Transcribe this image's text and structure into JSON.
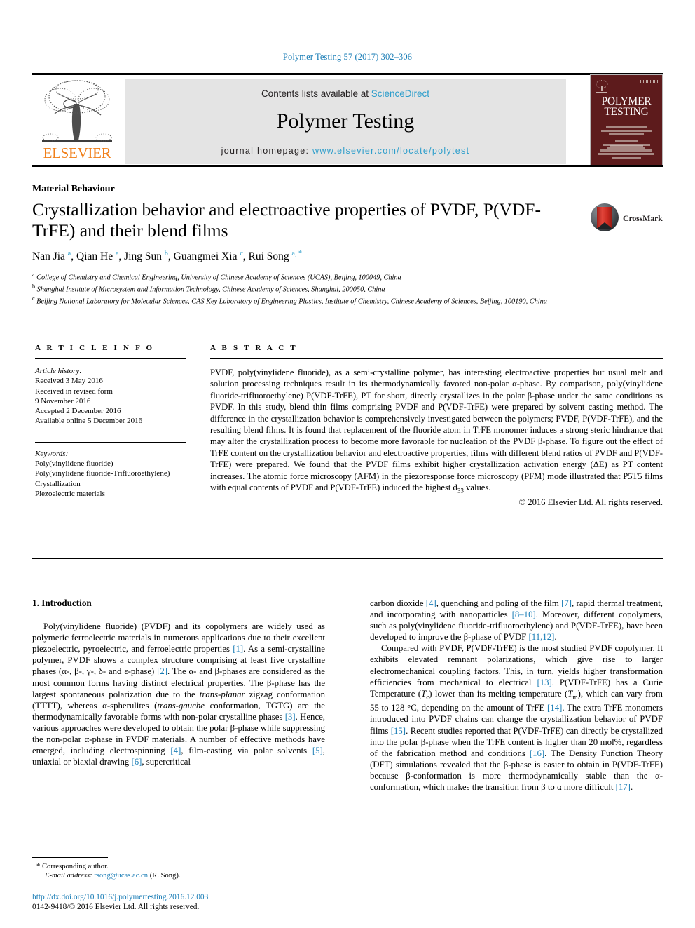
{
  "running_head": "Polymer Testing 57 (2017) 302–306",
  "masthead": {
    "contents_text": "Contents lists available at ",
    "sciencedirect": "ScienceDirect",
    "journal_title": "Polymer Testing",
    "homepage_label": "journal homepage: ",
    "homepage_url": "www.elsevier.com/locate/polytest",
    "publisher": "ELSEVIER",
    "cover_title_line1": "POLYMER",
    "cover_title_line2": "TESTING",
    "link_color": "#2e9ecb",
    "cover_color": "#5d1b1c",
    "publisher_color": "#f07f19"
  },
  "article": {
    "section_label": "Material Behaviour",
    "title": "Crystallization behavior and electroactive properties of PVDF, P(VDF-TrFE) and their blend films",
    "crossmark_label": "CrossMark",
    "authors": [
      {
        "name": "Nan Jia",
        "marks": "a"
      },
      {
        "name": "Qian He",
        "marks": "a"
      },
      {
        "name": "Jing Sun",
        "marks": "b"
      },
      {
        "name": "Guangmei Xia",
        "marks": "c"
      },
      {
        "name": "Rui Song",
        "marks": "a, *"
      }
    ],
    "affiliations": [
      {
        "mark": "a",
        "text": "College of Chemistry and Chemical Engineering, University of Chinese Academy of Sciences (UCAS), Beijing, 100049, China"
      },
      {
        "mark": "b",
        "text": "Shanghai Institute of Microsystem and Information Technology, Chinese Academy of Sciences, Shanghai, 200050, China"
      },
      {
        "mark": "c",
        "text": "Beijing National Laboratory for Molecular Sciences, CAS Key Laboratory of Engineering Plastics, Institute of Chemistry, Chinese Academy of Sciences, Beijing, 100190, China"
      }
    ]
  },
  "article_info": {
    "heading": "A R T I C L E   I N F O",
    "history_label": "Article history:",
    "history": [
      "Received 3 May 2016",
      "Received in revised form",
      "9 November 2016",
      "Accepted 2 December 2016",
      "Available online 5 December 2016"
    ],
    "keywords_label": "Keywords:",
    "keywords": [
      "Poly(vinylidene fluoride)",
      "Poly(vinylidene fluoride-Trifluoroethylene)",
      "Crystallization",
      "Piezoelectric materials"
    ]
  },
  "abstract": {
    "heading": "A B S T R A C T",
    "text": "PVDF, poly(vinylidene fluoride), as a semi-crystalline polymer, has interesting electroactive properties but usual melt and solution processing techniques result in its thermodynamically favored non-polar α-phase. By comparison, poly(vinylidene fluoride-trifluoroethylene) P(VDF-TrFE), PT for short, directly crystallizes in the polar β-phase under the same conditions as PVDF. In this study, blend thin films comprising PVDF and P(VDF-TrFE) were prepared by solvent casting method. The difference in the crystallization behavior is comprehensively investigated between the polymers; PVDF, P(VDF-TrFE), and the resulting blend films. It is found that replacement of the fluoride atom in TrFE monomer induces a strong steric hindrance that may alter the crystallization process to become more favorable for nucleation of the PVDF β-phase. To figure out the effect of TrFE content on the crystallization behavior and electroactive properties, films with different blend ratios of PVDF and P(VDF-TrFE) were prepared. We found that the PVDF films exhibit higher crystallization activation energy (ΔE) as PT content increases. The atomic force microscopy (AFM) in the piezoresponse force microscopy (PFM) mode illustrated that P5T5 films with equal contents of PVDF and P(VDF-TrFE) induced the highest d₃₃ values.",
    "copyright": "© 2016 Elsevier Ltd. All rights reserved."
  },
  "introduction": {
    "heading": "1. Introduction",
    "left_paragraph": "Poly(vinylidene fluoride) (PVDF) and its copolymers are widely used as polymeric ferroelectric materials in numerous applications due to their excellent piezoelectric, pyroelectric, and ferroelectric properties [1]. As a semi-crystalline polymer, PVDF shows a complex structure comprising at least five crystalline phases (α-, β-, γ-, δ- and ε-phase) [2]. The α- and β-phases are considered as the most common forms having distinct electrical properties. The β-phase has the largest spontaneous polarization due to the trans-planar zigzag conformation (TTTT), whereas α-spherulites (trans-gauche conformation, TGTG) are the thermodynamically favorable forms with non-polar crystalline phases [3]. Hence, various approaches were developed to obtain the polar β-phase while suppressing the non-polar α-phase in PVDF materials. A number of effective methods have emerged, including electrospinning [4], film-casting via polar solvents [5], uniaxial or biaxial drawing [6], supercritical",
    "right_paragraph_1": "carbon dioxide [4], quenching and poling of the film [7], rapid thermal treatment, and incorporating with nanoparticles [8–10]. Moreover, different copolymers, such as poly(vinylidene fluoride-trifluoroethylene) and P(VDF-TrFE), have been developed to improve the β-phase of PVDF [11,12].",
    "right_paragraph_2": "Compared with PVDF, P(VDF-TrFE) is the most studied PVDF copolymer. It exhibits elevated remnant polarizations, which give rise to larger electromechanical coupling factors. This, in turn, yields higher transformation efficiencies from mechanical to electrical [13]. P(VDF-TrFE) has a Curie Temperature (Tc) lower than its melting temperature (Tm), which can vary from 55 to 128 °C, depending on the amount of TrFE [14]. The extra TrFE monomers introduced into PVDF chains can change the crystallization behavior of PVDF films [15]. Recent studies reported that P(VDF-TrFE) can directly be crystallized into the polar β-phase when the TrFE content is higher than 20 mol%, regardless of the fabrication method and conditions [16]. The Density Function Theory (DFT) simulations revealed that the β-phase is easier to obtain in P(VDF-TrFE) because β-conformation is more thermodynamically stable than the α-conformation, which makes the transition from β to α more difficult [17]."
  },
  "footnote": {
    "corresponding_marker": "*",
    "corresponding_text": "Corresponding author.",
    "email_label": "E-mail address:",
    "email": "rsong@ucas.ac.cn",
    "email_suffix": "(R. Song)."
  },
  "page_footer": {
    "doi": "http://dx.doi.org/10.1016/j.polymertesting.2016.12.003",
    "issn_line": "0142-9418/© 2016 Elsevier Ltd. All rights reserved."
  }
}
